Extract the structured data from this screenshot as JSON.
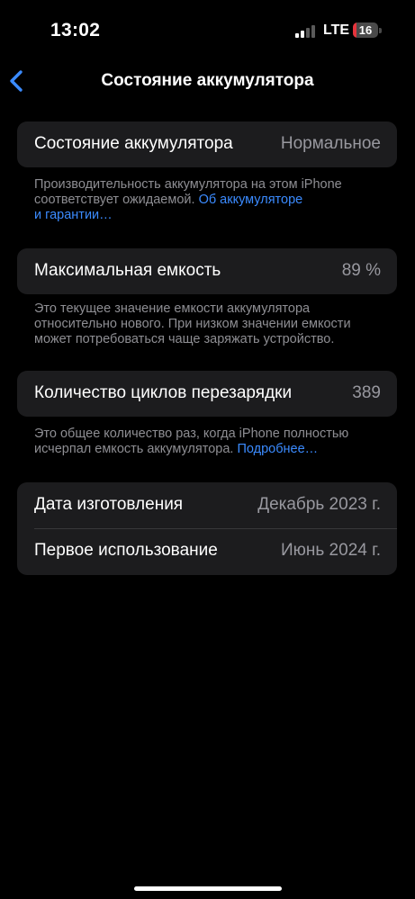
{
  "status_bar": {
    "time": "13:02",
    "network": "LTE",
    "battery_level": "16",
    "battery_fill_fraction": 0.16,
    "icons": [
      "cellular-signal-icon",
      "battery-icon"
    ]
  },
  "nav": {
    "title": "Состояние аккумулятора",
    "back_icon": "chevron-left-icon"
  },
  "health": {
    "label": "Состояние аккумулятора",
    "value": "Нормальное",
    "note": "Производительность аккумулятора на этом iPhone соответствует ожидаемой.",
    "link_line1": "Об аккумуляторе",
    "link_line2": "и гарантии…"
  },
  "capacity": {
    "label": "Максимальная емкость",
    "value": "89 %",
    "note": "Это текущее значение емкости аккумулятора относительно нового. При низком значении емкости может потребоваться чаще заряжать устройство."
  },
  "cycles": {
    "label": "Количество циклов перезарядки",
    "value": "389",
    "note": "Это общее количество раз, когда iPhone полностью исчерпал емкость аккумулятора.",
    "link": "Подробнее…"
  },
  "dates": {
    "manufactured_label": "Дата изготовления",
    "manufactured_value": "Декабрь 2023 г.",
    "first_use_label": "Первое использование",
    "first_use_value": "Июнь 2024 г."
  },
  "colors": {
    "accent": "#3b8bff",
    "battery_low": "#e6343c",
    "card": "#1c1c1e",
    "secondary_text": "#98989f"
  }
}
